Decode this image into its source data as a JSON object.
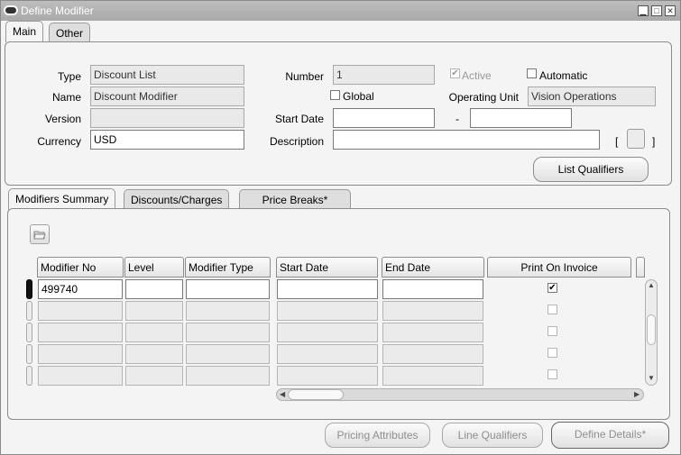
{
  "window": {
    "title": "Define Modifier",
    "minimize_label": "▁",
    "maximize_label": "□",
    "close_label": "✕"
  },
  "tabs_top": [
    {
      "label": "Main",
      "active": true
    },
    {
      "label": "Other",
      "active": false
    }
  ],
  "header": {
    "type_label": "Type",
    "type_value": "Discount List",
    "name_label": "Name",
    "name_value": "Discount Modifier",
    "version_label": "Version",
    "version_value": "",
    "currency_label": "Currency",
    "currency_value": "USD",
    "number_label": "Number",
    "number_value": "1",
    "global_label": "Global",
    "global_checked": false,
    "start_date_label": "Start Date",
    "start_date_value": "",
    "date_dash": "-",
    "end_date_value": "",
    "description_label": "Description",
    "description_value": "",
    "active_label": "Active",
    "active_checked": true,
    "automatic_label": "Automatic",
    "automatic_checked": false,
    "operating_unit_label": "Operating Unit",
    "operating_unit_value": "Vision Operations",
    "dff_open": "[",
    "dff_close": "]",
    "list_qualifiers_label": "List Qualifiers"
  },
  "tabs_lines": [
    {
      "label": "Modifiers Summary",
      "active": true
    },
    {
      "label": "Discounts/Charges",
      "active": false
    },
    {
      "label": "Price Breaks*",
      "active": false
    }
  ],
  "grid": {
    "columns": [
      "Modifier No",
      "Level",
      "Modifier Type",
      "Start Date",
      "End Date",
      "Print On Invoice"
    ],
    "rows": [
      {
        "modifier_no": "499740",
        "level": "",
        "modifier_type": "",
        "start_date": "",
        "end_date": "",
        "print_on_invoice": true
      },
      {
        "modifier_no": "",
        "level": "",
        "modifier_type": "",
        "start_date": "",
        "end_date": "",
        "print_on_invoice": false
      },
      {
        "modifier_no": "",
        "level": "",
        "modifier_type": "",
        "start_date": "",
        "end_date": "",
        "print_on_invoice": false
      },
      {
        "modifier_no": "",
        "level": "",
        "modifier_type": "",
        "start_date": "",
        "end_date": "",
        "print_on_invoice": false
      },
      {
        "modifier_no": "",
        "level": "",
        "modifier_type": "",
        "start_date": "",
        "end_date": "",
        "print_on_invoice": false
      }
    ]
  },
  "footer_buttons": {
    "pricing_attributes": "Pricing Attributes",
    "line_qualifiers": "Line Qualifiers",
    "define_details": "Define Details*"
  },
  "colors": {
    "titlebar": "#b0b0b0",
    "readonly_bg": "#e9e9e9"
  },
  "icons": [
    "app-icon",
    "open-folder-icon",
    "check-icon"
  ]
}
